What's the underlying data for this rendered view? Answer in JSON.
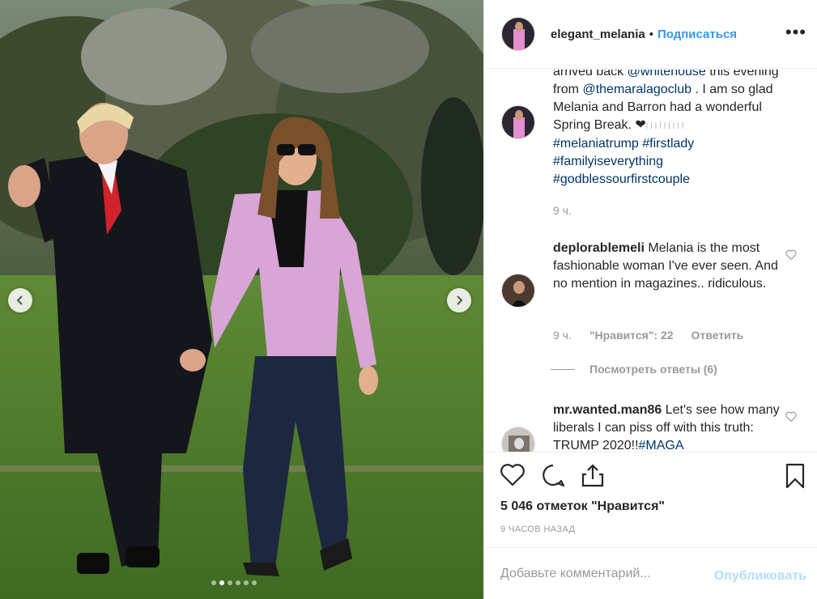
{
  "post": {
    "username": "elegant_melania",
    "separator": "•",
    "follow_label": "Подписаться",
    "more_label": "•••"
  },
  "caption": {
    "line_partial_1": "arrived back ",
    "mention_1": "@whitehouse",
    "line_partial_2": " this evening from ",
    "mention_2": "@themaralagoclub",
    "line_partial_3": " . I am so glad Melania and Barron had a wonderful Spring Break. ",
    "heart": "❤",
    "bars": "l l l l l l l l l",
    "hashtags": [
      "#melaniatrump",
      "#firstlady",
      "#familyiseverything",
      "#godblessourfirstcouple"
    ],
    "time": "9 ч."
  },
  "comments": [
    {
      "username": "deplorablemeli",
      "text": " Melania is the most fashionable woman I've ever seen. And no mention in magazines.. ridiculous.",
      "time": "9 ч.",
      "likes": "\"Нравится\": 22",
      "reply": "Ответить",
      "view_replies": "Посмотреть ответы (6)"
    },
    {
      "username": "mr.wanted.man86",
      "text": " Let's see how many liberals I can piss off with this truth: TRUMP 2020!!",
      "hashtag": "#MAGA"
    }
  ],
  "stats": {
    "likes": "5 046 отметок \"Нравится\"",
    "time_ago": "9 ЧАСОВ НАЗАД"
  },
  "composer": {
    "placeholder": "Добавьте комментарий...",
    "publish": "Опубликовать"
  },
  "carousel": {
    "slide_count": 6,
    "active_index": 1
  },
  "colors": {
    "link": "#003569",
    "accent": "#3897f0",
    "publish_disabled": "#b2dffc",
    "muted": "#999999"
  }
}
